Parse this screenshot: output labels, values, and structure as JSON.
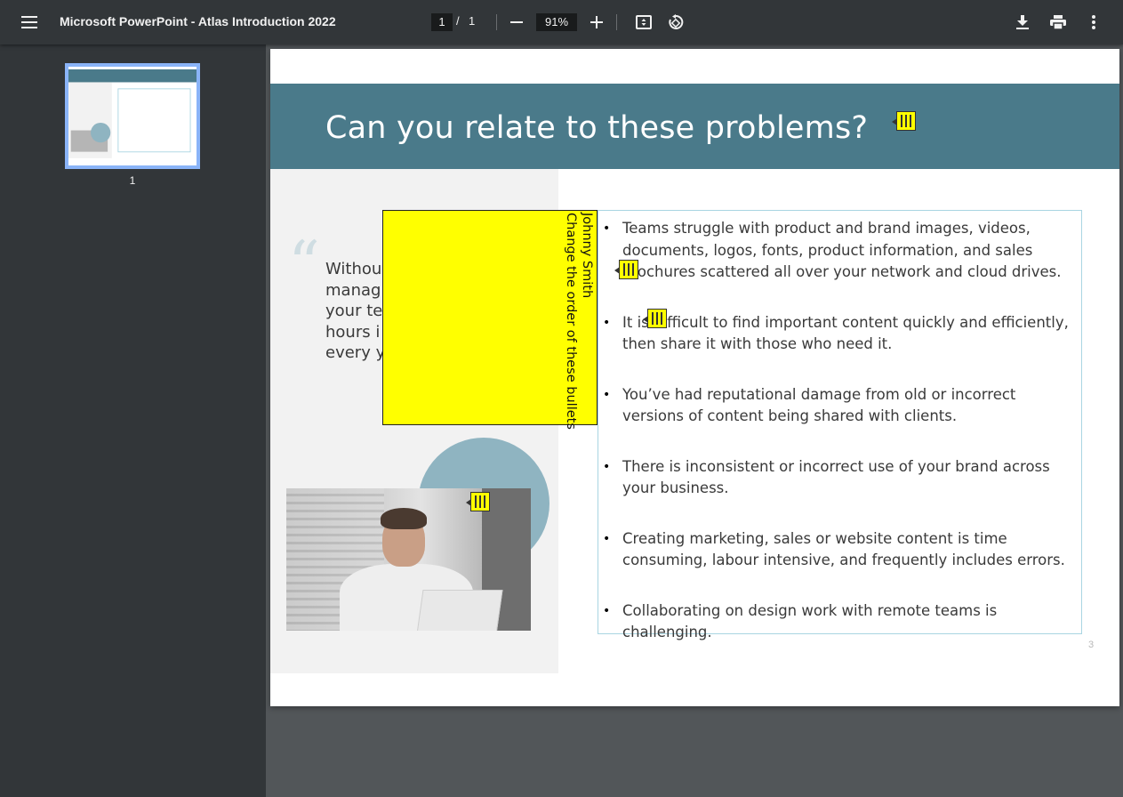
{
  "toolbar": {
    "title": "Microsoft PowerPoint - Atlas Introduction 2022",
    "page_current": "1",
    "page_separator": "/",
    "page_total": "1",
    "zoom": "91%",
    "icons": [
      "menu-icon",
      "minus-icon",
      "plus-icon",
      "fit-page-icon",
      "rotate-icon",
      "download-icon",
      "print-icon",
      "more-vert-icon"
    ]
  },
  "sidebar": {
    "thumbnails": [
      {
        "label": "1"
      }
    ]
  },
  "slide": {
    "title": "Can you relate to these problems?",
    "quote_mark": "“",
    "quote_lines": [
      "Withou",
      "manag",
      "your te",
      "hours i",
      "every y"
    ],
    "bullets": [
      "Teams struggle with product and brand images, videos, documents, logos, fonts, product information, and sales brochures scattered all over your network and cloud drives.",
      "It is difficult to find important content quickly and efficiently, then share it with those who need it.",
      "You’ve had reputational damage from old or incorrect versions of content being shared with clients.",
      "There is inconsistent or incorrect use of your brand across your business.",
      "Creating marketing, sales or website content is time consuming, labour intensive, and frequently includes errors.",
      "Collaborating on design work with remote teams is challenging."
    ],
    "page_number": "3"
  },
  "annotation": {
    "author": "Johnny Smith",
    "comment": "Change the order of these bullets"
  },
  "colors": {
    "toolbar_bg": "#323639",
    "viewer_bg": "#525659",
    "banner": "#4a7a8a",
    "sticky": "#ffff00",
    "thumb_border": "#8ab4f8"
  }
}
